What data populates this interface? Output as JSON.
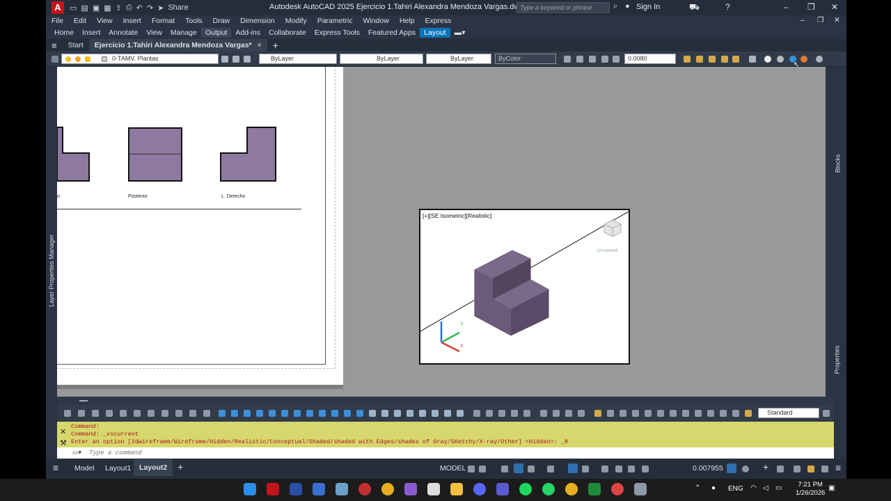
{
  "app": {
    "title": "Autodesk AutoCAD 2025    Ejercicio 1.Tahiri Alexandra Mendoza Vargas.dwg",
    "logo": "A",
    "share": "Share",
    "search_placeholder": "Type a keyword or phrase",
    "sign_in": "Sign In"
  },
  "menubar": [
    "File",
    "Edit",
    "View",
    "Insert",
    "Format",
    "Tools",
    "Draw",
    "Dimension",
    "Modify",
    "Parametric",
    "Window",
    "Help",
    "Express"
  ],
  "ribbon_tabs": [
    "Home",
    "Insert",
    "Annotate",
    "View",
    "Manage",
    "Output",
    "Add-ins",
    "Collaborate",
    "Express Tools",
    "Featured Apps",
    "Layout"
  ],
  "ribbon_active": "Output",
  "ribbon_contextual": "Layout",
  "file_tabs": {
    "start": "Start",
    "active": "Ejercicio 1.Tahiri Alexandra Mendoza Vargas*",
    "close": "×",
    "add": "+"
  },
  "properties_bar": {
    "layer": "0-TAMV. Plantas",
    "color": "ByLayer",
    "linetype": "ByLayer",
    "lineweight": "ByLayer",
    "plotstyle": "ByColor",
    "scale": "0.0080"
  },
  "left_panel_label": "Layer Properties Manager",
  "right_panel_labels": {
    "top": "Blocks",
    "bottom": "Properties"
  },
  "sheet_views": {
    "left_label": "o",
    "middle_label": "Posterior",
    "right_label": "L. Derecho"
  },
  "viewport": {
    "label": "[+][SE Isometric][Realistic]",
    "viewcube_label": "Unnamed",
    "ucs": {
      "x": "X",
      "y": "Y"
    }
  },
  "dimstyle": "Standard",
  "command_history": [
    "Command:",
    "Command: _vscurrent",
    "Enter an option [2dwireframe/Wireframe/Hidden/Realistic/Conceptual/Shaded/shaded with Edges/shades of Gray/SKetchy/X-ray/Other] <Hidden>: _R"
  ],
  "command_placeholder": "Type a command",
  "layout_tabs": [
    "Model",
    "Layout1",
    "Layout2"
  ],
  "layout_active": "Layout2",
  "status": {
    "mode": "MODEL",
    "scale": "0.007955"
  },
  "taskbar": {
    "lang": "ENG",
    "time": "7:21 PM",
    "date": "1/26/2026"
  },
  "colors": {
    "accent": "#0b74b8",
    "command_bg": "#d6d76c",
    "solid": "#5e4d6b",
    "view_fill": "#8e7aa0"
  }
}
